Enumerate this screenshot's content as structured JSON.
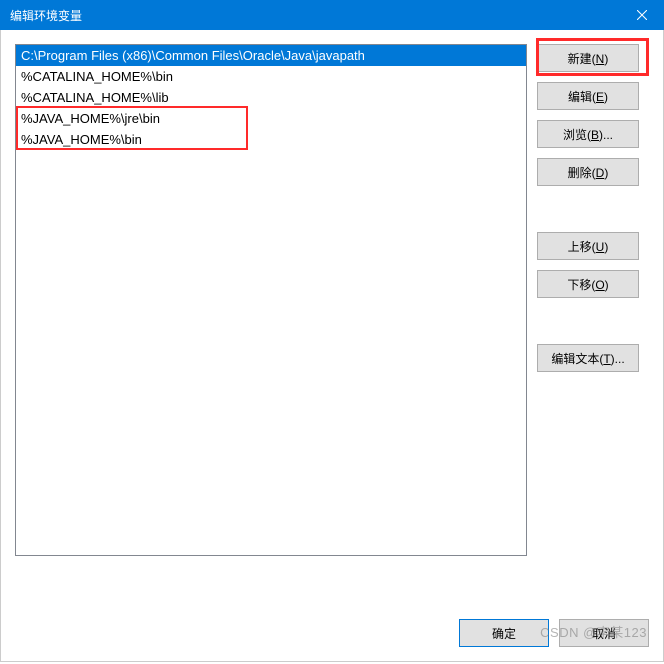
{
  "titlebar": {
    "title": "编辑环境变量"
  },
  "list": {
    "items": [
      {
        "text": "C:\\Program Files (x86)\\Common Files\\Oracle\\Java\\javapath",
        "selected": true
      },
      {
        "text": "%CATALINA_HOME%\\bin",
        "selected": false
      },
      {
        "text": "%CATALINA_HOME%\\lib",
        "selected": false
      },
      {
        "text": "%JAVA_HOME%\\jre\\bin",
        "selected": false
      },
      {
        "text": "%JAVA_HOME%\\bin",
        "selected": false
      }
    ]
  },
  "buttons": {
    "new_label": "新建(",
    "new_key": "N",
    "new_suffix": ")",
    "edit_label": "编辑(",
    "edit_key": "E",
    "edit_suffix": ")",
    "browse_label": "浏览(",
    "browse_key": "B",
    "browse_suffix": ")...",
    "delete_label": "删除(",
    "delete_key": "D",
    "delete_suffix": ")",
    "moveup_label": "上移(",
    "moveup_key": "U",
    "moveup_suffix": ")",
    "movedown_label": "下移(",
    "movedown_key": "O",
    "movedown_suffix": ")",
    "edittext_label": "编辑文本(",
    "edittext_key": "T",
    "edittext_suffix": ")...",
    "ok_label": "确定",
    "cancel_label": "取消"
  },
  "watermark": "CSDN @李某123"
}
